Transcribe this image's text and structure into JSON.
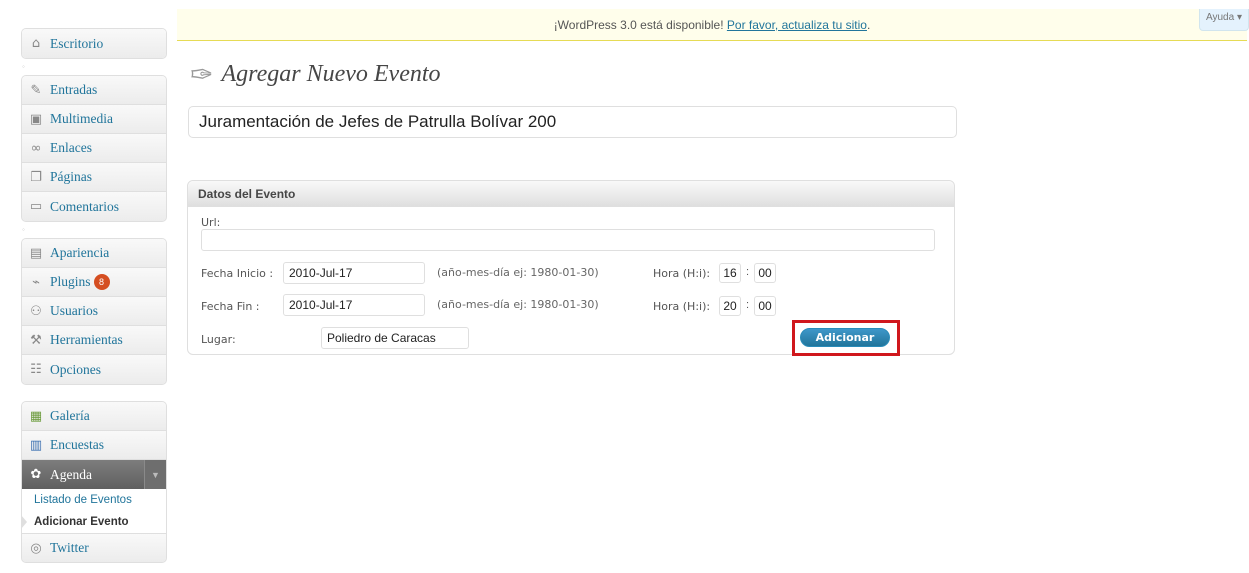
{
  "notice": {
    "text": "¡WordPress 3.0 está disponible! ",
    "link": "Por favor, actualiza tu sitio",
    "end": "."
  },
  "help": "Ayuda ▾",
  "sidebar": {
    "group1": [
      {
        "label": "Escritorio",
        "icon": "house-icon"
      }
    ],
    "group2": [
      {
        "label": "Entradas",
        "icon": "pin-icon"
      },
      {
        "label": "Multimedia",
        "icon": "media-icon"
      },
      {
        "label": "Enlaces",
        "icon": "link-icon"
      },
      {
        "label": "Páginas",
        "icon": "pages-icon"
      },
      {
        "label": "Comentarios",
        "icon": "comment-icon"
      }
    ],
    "group3": [
      {
        "label": "Apariencia",
        "icon": "appearance-icon"
      },
      {
        "label": "Plugins",
        "icon": "plugin-icon",
        "badge": "8"
      },
      {
        "label": "Usuarios",
        "icon": "users-icon"
      },
      {
        "label": "Herramientas",
        "icon": "tools-icon"
      },
      {
        "label": "Opciones",
        "icon": "settings-icon"
      }
    ],
    "group4": [
      {
        "label": "Galería",
        "icon": "gallery-icon"
      },
      {
        "label": "Encuestas",
        "icon": "polls-icon"
      },
      {
        "label": "Agenda",
        "icon": "agenda-icon"
      }
    ],
    "submenu": [
      "Listado de Eventos",
      "Adicionar Evento"
    ],
    "twitter": "Twitter"
  },
  "page": {
    "title": "Agregar Nuevo Evento",
    "event_title": "Juramentación de Jefes de Patrulla Bolívar 200"
  },
  "box": {
    "heading": "Datos del Evento",
    "url_label": "Url:",
    "url_value": "",
    "start_label": "Fecha Inicio :",
    "start_value": "2010-Jul-17",
    "date_hint": "(año-mes-día ej: 1980-01-30)",
    "time_label": "Hora (H:i):",
    "start_hour": "16",
    "start_min": "00",
    "end_label": "Fecha Fin :",
    "end_value": "2010-Jul-17",
    "end_hour": "20",
    "end_min": "00",
    "place_label": "Lugar:",
    "place_value": "Poliedro de Caracas",
    "add_button": "Adicionar"
  }
}
